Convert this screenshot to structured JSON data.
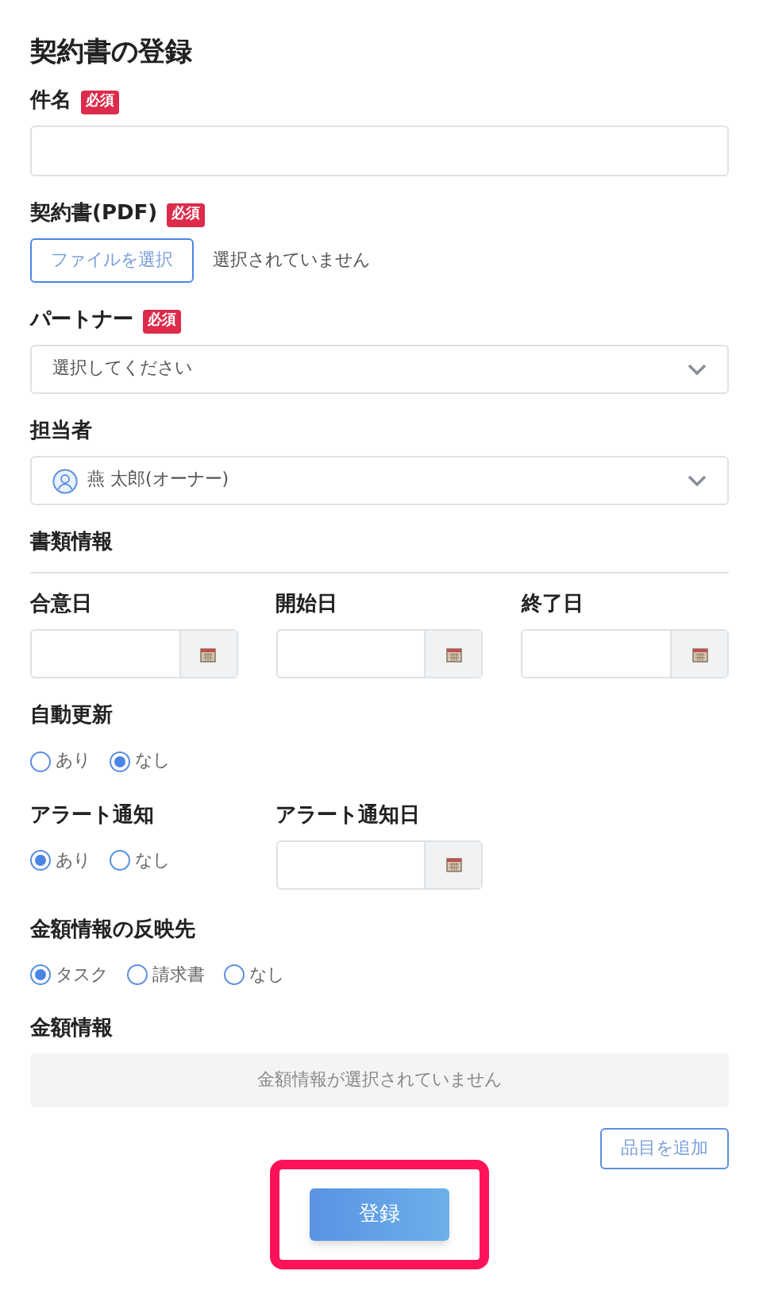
{
  "title": "契約書の登録",
  "fields": [
    {
      "kind": "text",
      "label": "件名",
      "required_badge": "必須"
    },
    {
      "kind": "file",
      "label": "契約書(PDF)",
      "required_badge": "必須",
      "button": "ファイルを選択",
      "status": "選択されていません"
    },
    {
      "kind": "select",
      "label": "パートナー",
      "required_badge": "必須",
      "placeholder": "選択してください"
    },
    {
      "kind": "select",
      "label": "担当者",
      "value": "燕 太郎(オーナー)"
    }
  ],
  "section_title": "書類情報",
  "date_fields": [
    {
      "label": "合意日"
    },
    {
      "label": "開始日"
    },
    {
      "label": "終了日"
    }
  ],
  "auto_renew": {
    "label": "自動更新",
    "options": [
      {
        "label": "あり",
        "selected": false
      },
      {
        "label": "なし",
        "selected": true
      }
    ]
  },
  "alert": {
    "label": "アラート通知",
    "options": [
      {
        "label": "あり",
        "selected": true
      },
      {
        "label": "なし",
        "selected": false
      }
    ]
  },
  "alert_date": {
    "label": "アラート通知日"
  },
  "amount_target": {
    "label": "金額情報の反映先",
    "options": [
      {
        "label": "タスク",
        "selected": true
      },
      {
        "label": "請求書",
        "selected": false
      },
      {
        "label": "なし",
        "selected": false
      }
    ]
  },
  "amount": {
    "label": "金額情報",
    "empty_message": "金額情報が選択されていません",
    "add_button": "品目を追加"
  },
  "submit_button": "登録"
}
